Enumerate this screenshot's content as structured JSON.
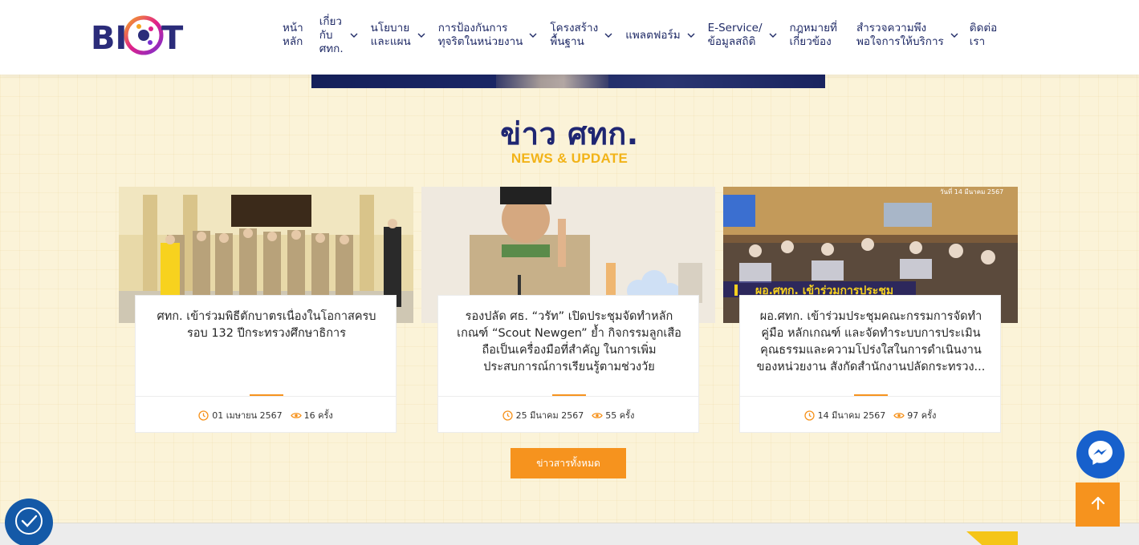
{
  "header": {
    "logo_text": "BICT",
    "nav": [
      {
        "label": "หน้า\nหลัก",
        "dropdown": false
      },
      {
        "label": "เกี่ยว\nกับ\nศทก.",
        "dropdown": true
      },
      {
        "label": "นโยบาย\nและแผน",
        "dropdown": true
      },
      {
        "label": "การป้องกันการ\nทุจริตในหน่วยงาน",
        "dropdown": true
      },
      {
        "label": "โครงสร้าง\nพื้นฐาน",
        "dropdown": true
      },
      {
        "label": "แพลตฟอร์ม",
        "dropdown": true
      },
      {
        "label": "E-Service/\nข้อมูลสถิติ",
        "dropdown": true
      },
      {
        "label": "กฎหมายที่\nเกี่ยวข้อง",
        "dropdown": false
      },
      {
        "label": "สำรวจความพึง\nพอใจการให้บริการ",
        "dropdown": true
      },
      {
        "label": "ติดต่อ\nเรา",
        "dropdown": false
      }
    ]
  },
  "section": {
    "title": "ข่าว ศทก.",
    "subtitle": "NEWS & UPDATE"
  },
  "news": [
    {
      "title": "ศทก. เข้าร่วมพิธีตักบาตรเนื่องในโอกาสครบรอบ 132 ปีกระทรวงศึกษาธิการ",
      "date": "01 เมษายน 2567",
      "views": "16",
      "views_unit": "ครั้ง"
    },
    {
      "title": "รองปลัด ศธ. “วรัท” เปิดประชุมจัดทำหลักเกณฑ์ “Scout Newgen” ย้ำ กิจกรรมลูกเสือ ถือเป็นเครื่องมือที่สำคัญ ในการเพิ่มประสบการณ์การเรียนรู้ตามช่วงวัย",
      "date": "25 มีนาคม 2567",
      "views": "55",
      "views_unit": "ครั้ง"
    },
    {
      "title": "ผอ.ศทก. เข้าร่วมประชุมคณะกรรมการจัดทำคู่มือ หลักเกณฑ์ และจัดทำระบบการประเมินคุณธรรมและความโปร่งใสในการดำเนินงานของหน่วยงาน สังกัดสำนักงานปลัดกระทรวง...",
      "date": "14 มีนาคม 2567",
      "views": "97",
      "views_unit": "ครั้ง",
      "image_caption": "ผอ.ศทก. เข้าร่วมการประชุม",
      "image_date": "วันที่ 14 มีนาคม 2567"
    }
  ],
  "all_news_button": "ข่าวสารทั้งหมด",
  "colors": {
    "navy": "#1f2672",
    "gold": "#f2b318",
    "orange": "#f6931e",
    "background": "#fbf3d8",
    "messenger": "#1760cc",
    "accessibility": "#1459a7"
  },
  "icons": {
    "clock": "clock-icon",
    "eye": "eye-icon",
    "messenger": "messenger-icon",
    "arrow_up": "arrow-up-icon",
    "accessibility": "accessibility-icon"
  }
}
